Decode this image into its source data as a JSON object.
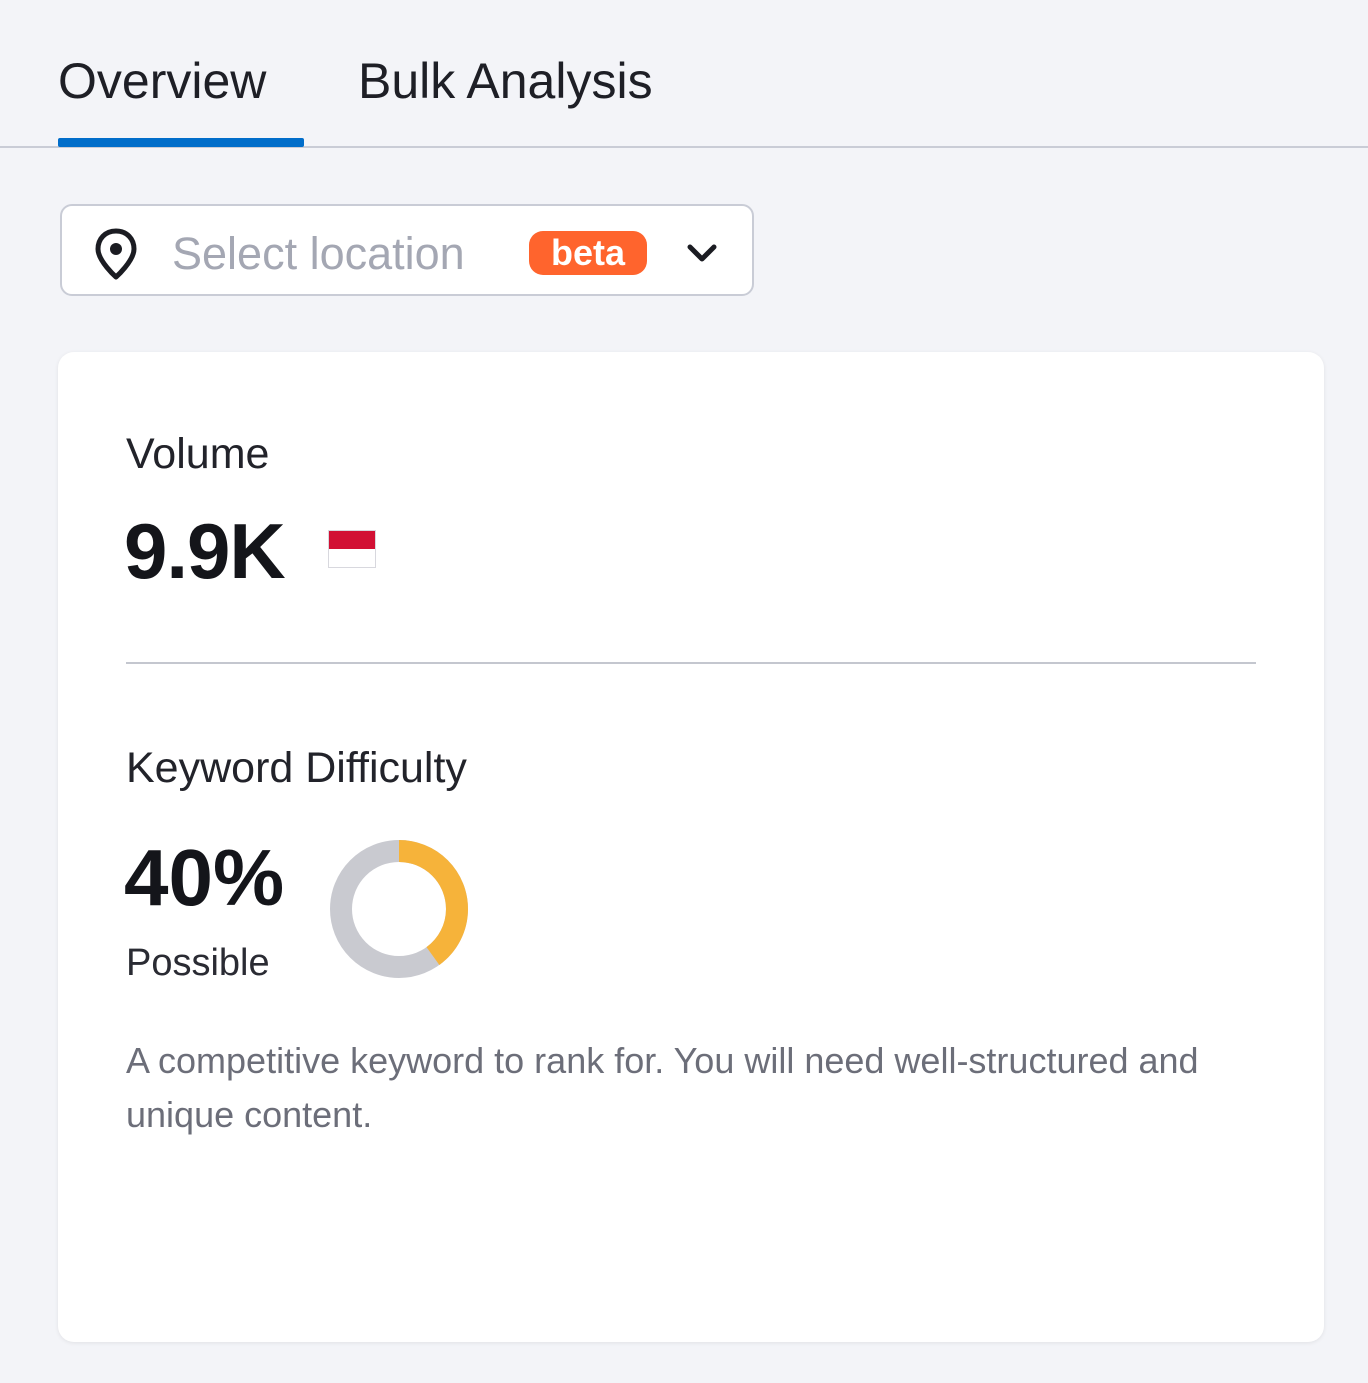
{
  "tabs": [
    {
      "label": "Overview",
      "active": true
    },
    {
      "label": "Bulk Analysis",
      "active": false
    }
  ],
  "location": {
    "placeholder": "Select location",
    "badge": "beta",
    "icon": "location-pin-icon",
    "chevron_icon": "chevron-down-icon"
  },
  "volume": {
    "label": "Volume",
    "value": "9.9K",
    "flag_icon": "indonesia-flag-icon"
  },
  "keyword_difficulty": {
    "label": "Keyword Difficulty",
    "value": "40%",
    "percent": 40,
    "status": "Possible",
    "description": "A competitive keyword to rank for. You will need well-structured and unique content."
  },
  "colors": {
    "accent": "#006dca",
    "badge": "#ff642d",
    "difficulty_fill": "#f6b33a",
    "difficulty_track": "#c9cad0"
  }
}
